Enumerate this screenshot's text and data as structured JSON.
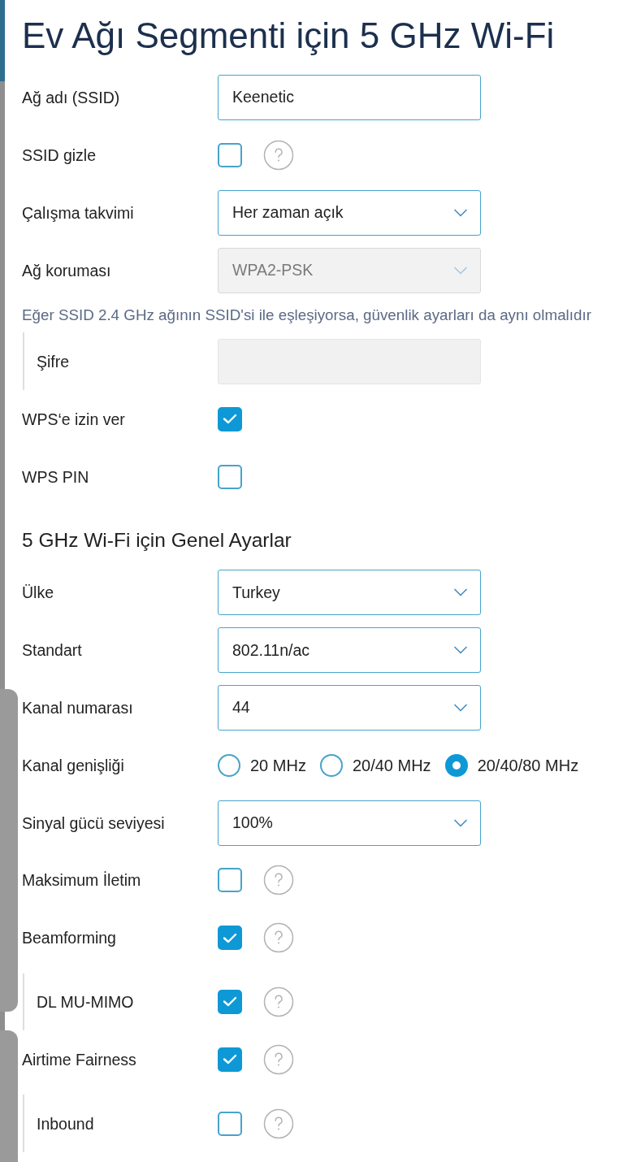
{
  "page_title": "Ev Ağı Segmenti için 5 GHz Wi-Fi",
  "segment_fields": [
    {
      "kind": "text",
      "label": "Ağ adı (SSID)",
      "value": "Keenetic"
    },
    {
      "kind": "checkbox",
      "label": "SSID gizle",
      "checked": false,
      "help": true
    },
    {
      "kind": "select",
      "label": "Çalışma takvimi",
      "value": "Her zaman açık",
      "disabled": false
    },
    {
      "kind": "select",
      "label": "Ağ koruması",
      "value": "WPA2-PSK",
      "disabled": true,
      "note": "Eğer SSID 2.4 GHz ağının SSID'si ile eşleşiyorsa, güvenlik ayarları da aynı olmalıdır",
      "children": [
        {
          "kind": "password",
          "label": "Şifre"
        }
      ]
    },
    {
      "kind": "checkbox",
      "label": "WPS‘e izin ver",
      "checked": true,
      "help": false
    },
    {
      "kind": "checkbox",
      "label": "WPS PIN",
      "checked": false,
      "help": false
    }
  ],
  "general_settings": {
    "heading": "5 GHz Wi-Fi için Genel Ayarlar",
    "fields": [
      {
        "kind": "select",
        "label": "Ülke",
        "value": "Turkey",
        "disabled": false
      },
      {
        "kind": "select",
        "label": "Standart",
        "value": "802.11n/ac",
        "disabled": false
      },
      {
        "kind": "select",
        "label": "Kanal numarası",
        "value": "44",
        "disabled": false
      },
      {
        "kind": "radio",
        "label": "Kanal genişliği",
        "options": [
          {
            "label": "20 MHz",
            "selected": false
          },
          {
            "label": "20/40 MHz",
            "selected": false
          },
          {
            "label": "20/40/80 MHz",
            "selected": true
          }
        ]
      },
      {
        "kind": "select",
        "label": "Sinyal gücü seviyesi",
        "value": "100%",
        "disabled": false
      },
      {
        "kind": "checkbox",
        "label": "Maksimum İletim",
        "checked": false,
        "help": true
      },
      {
        "kind": "checkbox",
        "label": "Beamforming",
        "checked": true,
        "help": true,
        "children": [
          {
            "kind": "checkbox",
            "label": "DL MU-MIMO",
            "checked": true,
            "help": true
          }
        ]
      },
      {
        "kind": "checkbox",
        "label": "Airtime Fairness",
        "checked": true,
        "help": true,
        "children": [
          {
            "kind": "checkbox",
            "label": "Inbound",
            "checked": false,
            "help": true
          }
        ]
      }
    ]
  }
}
